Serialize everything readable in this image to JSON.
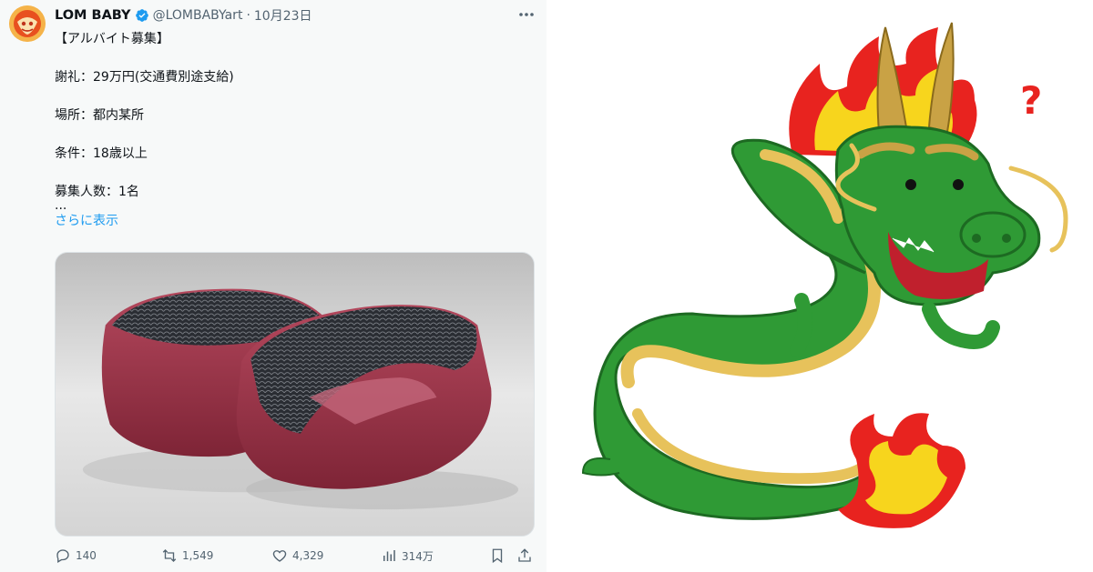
{
  "tweet": {
    "author_name": "LOM BABY",
    "handle": "@LOMBABYart",
    "separator": "·",
    "date": "10月23日",
    "text_lines": [
      "【アルバイト募集】",
      "謝礼：29万円(交通費別途支給)",
      "場所：都内某所",
      "条件：18歳以上",
      "募集人数：1名",
      "..."
    ],
    "show_more": "さらに表示",
    "metrics": {
      "replies": "140",
      "retweets": "1,549",
      "likes": "4,329",
      "views": "314万"
    },
    "icons": {
      "avatar": "lom-baby-avatar",
      "verified": "verified-badge-icon",
      "more": "more-options-icon",
      "reply": "reply-icon",
      "retweet": "retweet-icon",
      "like": "heart-icon",
      "views": "views-chart-icon",
      "bookmark": "bookmark-icon",
      "share": "share-icon"
    },
    "colors": {
      "link": "#1d9bf0",
      "muted": "#536471",
      "verified": "#1d9bf0"
    }
  },
  "illustration": {
    "question_mark": "?",
    "colors": {
      "dragon_body": "#2f9a35",
      "belly": "#e7c25b",
      "flame_outer": "#e8231f",
      "flame_inner": "#f7d51d",
      "question": "#e8231f"
    }
  }
}
